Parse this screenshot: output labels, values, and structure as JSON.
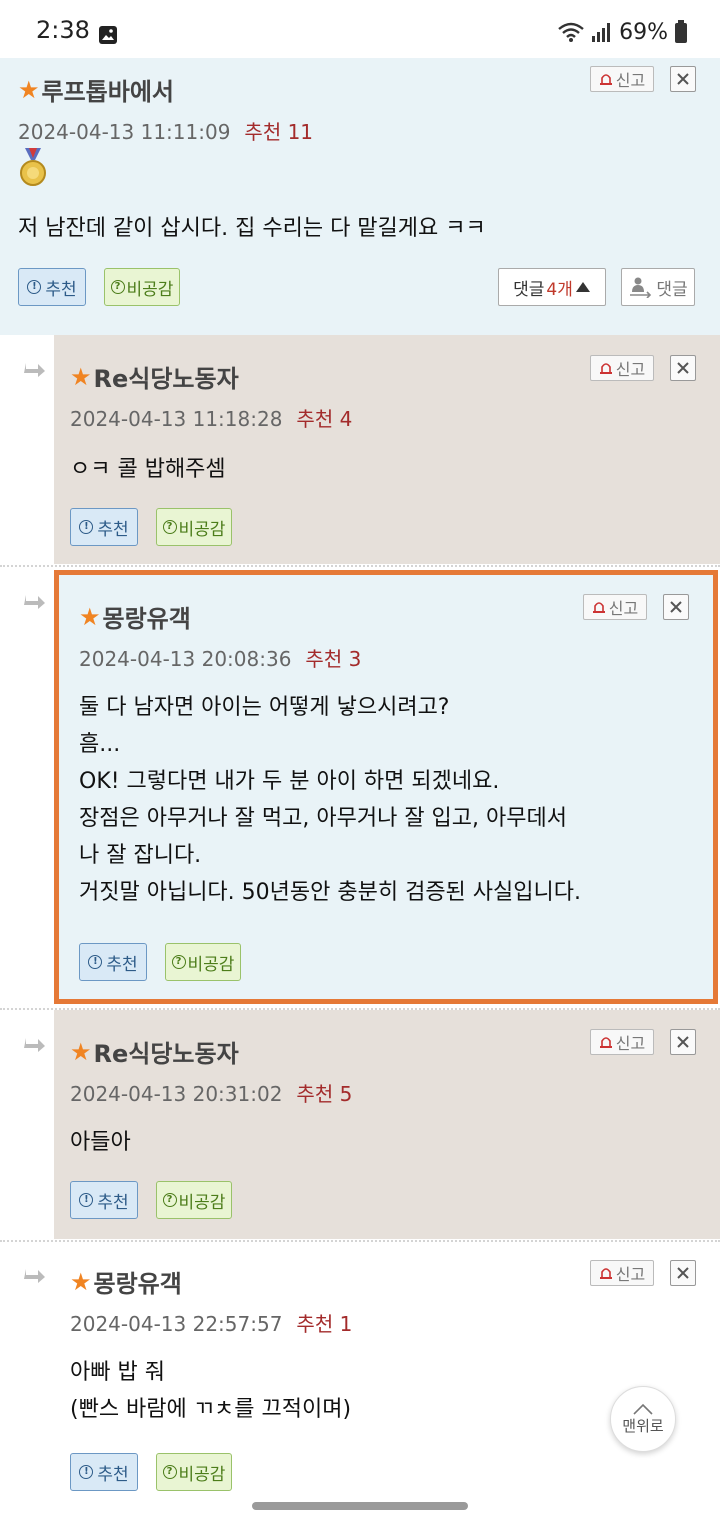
{
  "status_bar": {
    "time": "2:38",
    "battery": "69%"
  },
  "ui": {
    "report_label": "신고",
    "recommend_label": "추천",
    "disagree_label": "비공감",
    "replies_prefix": "댓글",
    "replies_count": "4개",
    "reply_label": "댓글",
    "back_to_top_label": "맨위로"
  },
  "colors": {
    "highlight_bg": "#e9f3f7",
    "reply_bg": "#e6e0da",
    "highlight_border": "#e57937",
    "star": "#f08422",
    "recommend_count": "#a32b2b"
  },
  "comments": [
    {
      "author": "루프톱바에서",
      "date": "2024-04-13 11:11:09",
      "recommend": "추천 11",
      "text": "저 남잔데 같이 삽시다. 집 수리는 다 맡길게요 ㅋㅋ",
      "has_medal": true
    },
    {
      "author": "Re식당노동자",
      "date": "2024-04-13 11:18:28",
      "recommend": "추천 4",
      "text": "ㅇㅋ 콜 밥해주셈"
    },
    {
      "author": "몽랑유객",
      "date": "2024-04-13 20:08:36",
      "recommend": "추천 3",
      "text": "둘 다 남자면 아이는 어떻게 낳으시려고?\n흠...\nOK! 그렇다면 내가 두 분 아이 하면 되겠네요.\n장점은 아무거나 잘 먹고, 아무거나 잘 입고, 아무데서\n나 잘 잡니다.\n거짓말 아닙니다. 50년동안 충분히 검증된 사실입니다.",
      "selected": true
    },
    {
      "author": "Re식당노동자",
      "date": "2024-04-13 20:31:02",
      "recommend": "추천 5",
      "text": "아들아"
    },
    {
      "author": "몽랑유객",
      "date": "2024-04-13 22:57:57",
      "recommend": "추천 1",
      "text": "아빠 밥 줘\n(빤스 바람에 ㄲㅊ를 끄적이며)"
    }
  ]
}
